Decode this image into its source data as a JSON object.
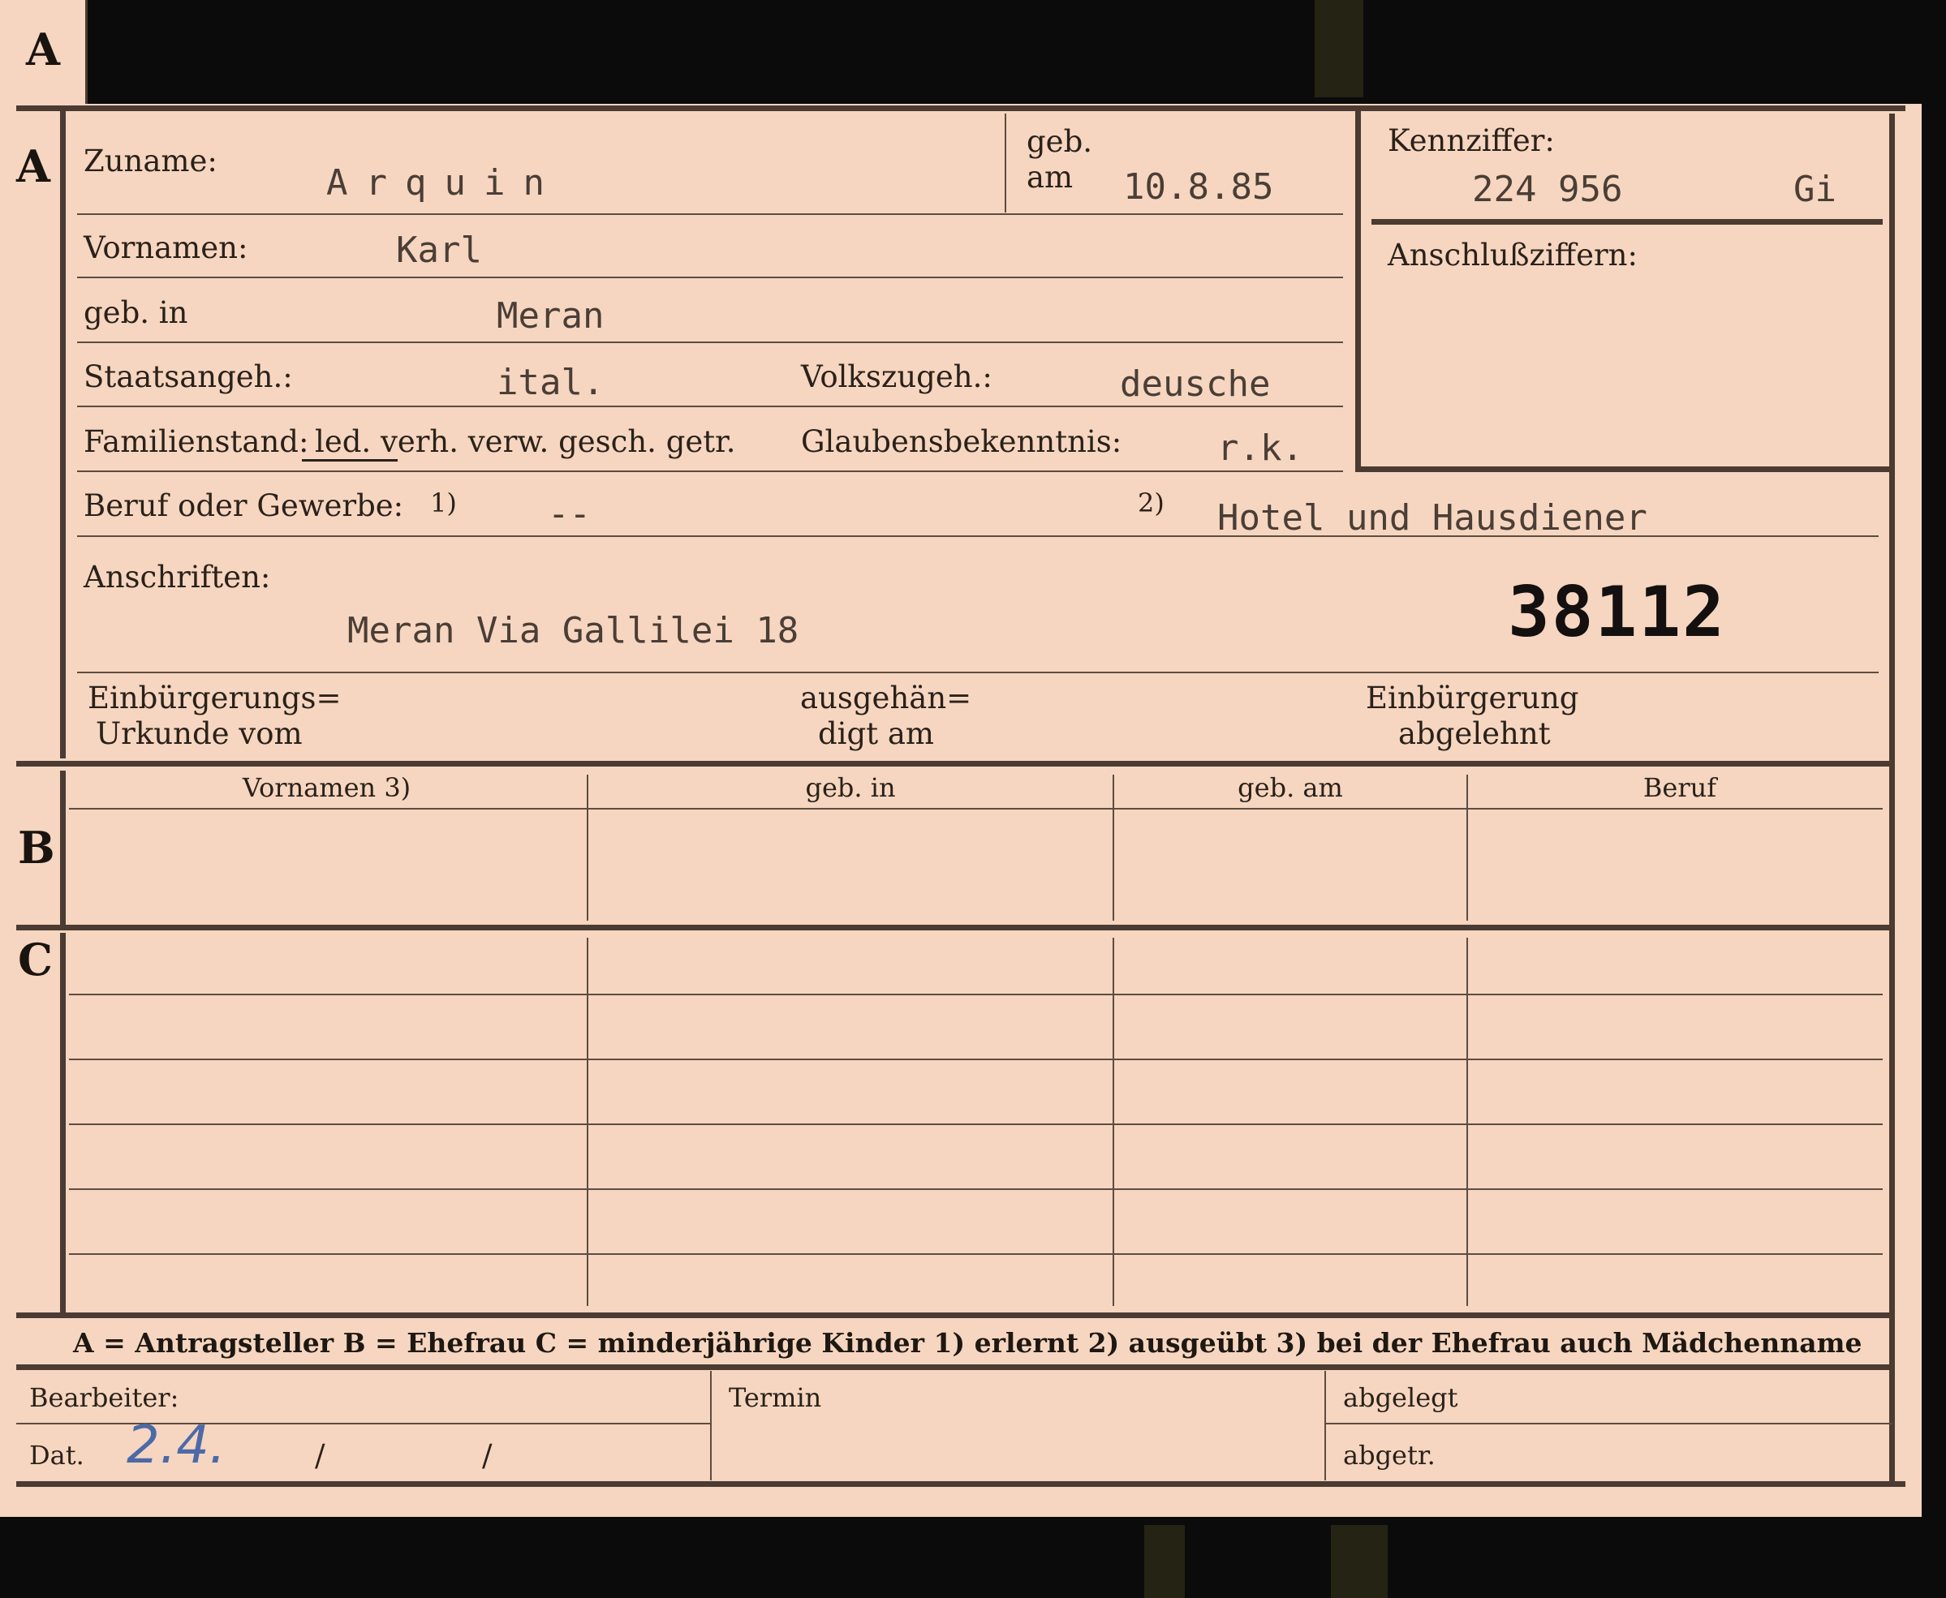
{
  "section_a": {
    "tab_letter": "A",
    "letter": "A",
    "surname_label": "Zuname:",
    "surname_value": "Arquin",
    "birthdate_label_1": "geb.",
    "birthdate_label_2": "am",
    "birthdate_value": "10.8.85",
    "given_names_label": "Vornamen:",
    "given_names_value": "Karl",
    "birthplace_label": "geb. in",
    "birthplace_value": "Meran",
    "citizenship_label": "Staatsangeh.:",
    "citizenship_value": "ital.",
    "ethnicity_label": "Volkszugeh.:",
    "ethnicity_value": "deusche",
    "marital_label": "Familienstand:",
    "marital_options": "led. verh. verw. gesch. getr.",
    "marital_selected": "led.",
    "religion_label": "Glaubensbekenntnis:",
    "religion_value": "r.k.",
    "occupation_label": "Beruf oder Gewerbe:",
    "occupation_learned_mark": "1)",
    "occupation_learned_value": "--",
    "occupation_practiced_mark": "2)",
    "occupation_practiced_value": "Hotel und Hausdiener",
    "address_label": "Anschriften:",
    "address_value": "Meran Via Gallilei 18",
    "file_number": "38112",
    "naturalization_doc_label_1": "Einbürgerungs=",
    "naturalization_doc_label_2": "Urkunde vom",
    "handed_label_1": "ausgehän=",
    "handed_label_2": "digt am",
    "rejected_label_1": "Einbürgerung",
    "rejected_label_2": "abgelehnt"
  },
  "id_box": {
    "kennziffer_label": "Kennziffer:",
    "kennziffer_value": "224 956",
    "kennziffer_suffix": "Gi",
    "anschluss_label": "Anschlußziffern:"
  },
  "section_b": {
    "letter": "B",
    "columns": [
      "Vornamen 3)",
      "geb. in",
      "geb. am",
      "Beruf"
    ]
  },
  "section_c": {
    "letter": "C"
  },
  "legend": {
    "text": "A = Antragsteller   B = Ehefrau   C = minderjährige Kinder   1) erlernt   2) ausgeübt   3) bei der Ehefrau auch Mädchenname"
  },
  "footer": {
    "clerk_label": "Bearbeiter:",
    "date_label": "Dat.",
    "date_handwritten": "2.4.",
    "slash_1": "/",
    "slash_2": "/",
    "deadline_label": "Termin",
    "filed_label": "abgelegt",
    "removed_label": "abgetr."
  }
}
